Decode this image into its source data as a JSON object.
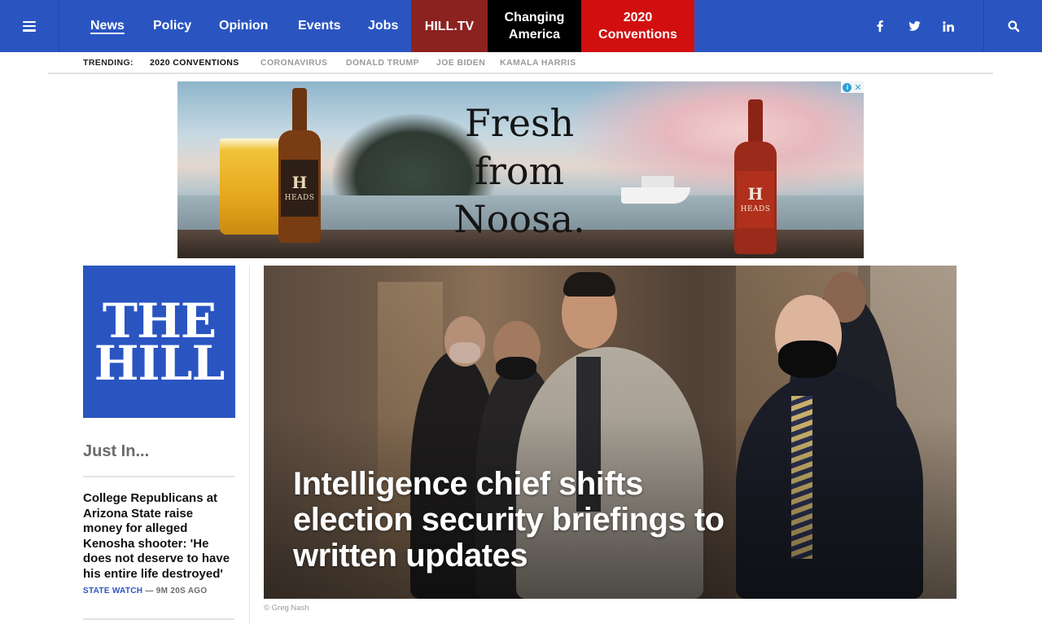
{
  "nav": {
    "menu_icon": "hamburger-icon",
    "links": [
      "News",
      "Policy",
      "Opinion",
      "Events",
      "Jobs"
    ],
    "hilltv": "HILL.TV",
    "changing_america": "Changing America",
    "conventions": "2020 Conventions",
    "social": [
      "f",
      "twitter-bird",
      "in"
    ],
    "search_icon": "search-icon",
    "colors": {
      "bar": "#2a55c1",
      "hilltv": "#8c2220",
      "changing_america": "#000000",
      "conventions": "#d10f0f"
    }
  },
  "trending": {
    "label": "TRENDING:",
    "items": [
      "2020 CONVENTIONS",
      "CORONAVIRUS",
      "DONALD TRUMP",
      "JOE BIDEN",
      "KAMALA HARRIS"
    ]
  },
  "ad": {
    "tagline_line1": "Fresh",
    "tagline_line2": "from",
    "tagline_line3": "Noosa.",
    "bottle_brand": "HEADS",
    "adchoices_icon": "adchoices-icon"
  },
  "logo": {
    "line1": "THE",
    "line2": "HILL"
  },
  "sidebar": {
    "heading": "Just In...",
    "stories": [
      {
        "title": "College Republicans at Arizona State raise money for alleged Kenosha shooter: 'He does not deserve to have his entire life destroyed'",
        "section": "STATE WATCH",
        "time": "9M 20S AGO"
      }
    ]
  },
  "hero": {
    "title": "Intelligence chief shifts election security briefings to written updates",
    "credit": "© Greg Nash"
  }
}
